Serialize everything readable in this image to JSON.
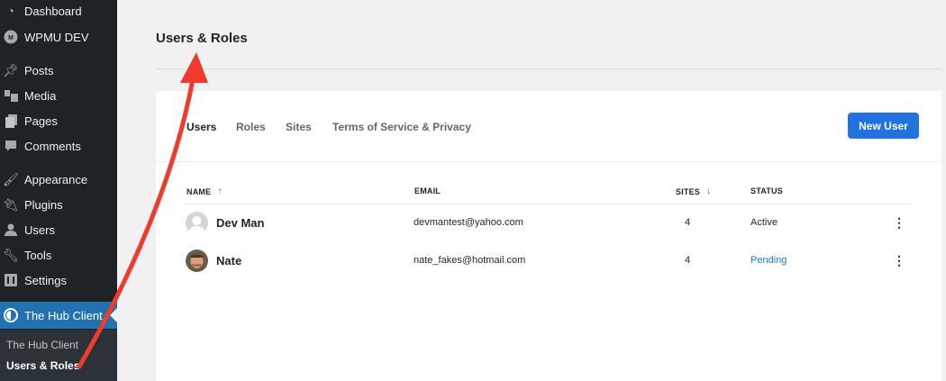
{
  "sidebar": {
    "items": [
      {
        "label": "Dashboard",
        "icon": "dashboard-icon"
      },
      {
        "label": "WPMU DEV",
        "icon": "wpmudev-icon"
      },
      {
        "label": "Posts",
        "icon": "pin-icon"
      },
      {
        "label": "Media",
        "icon": "media-icon"
      },
      {
        "label": "Pages",
        "icon": "pages-icon"
      },
      {
        "label": "Comments",
        "icon": "comment-icon"
      },
      {
        "label": "Appearance",
        "icon": "brush-icon"
      },
      {
        "label": "Plugins",
        "icon": "plugin-icon"
      },
      {
        "label": "Users",
        "icon": "user-icon"
      },
      {
        "label": "Tools",
        "icon": "wrench-icon"
      },
      {
        "label": "Settings",
        "icon": "settings-icon"
      },
      {
        "label": "The Hub Client",
        "icon": "hub-icon"
      }
    ],
    "submenu": [
      "The Hub Client",
      "Users & Roles"
    ]
  },
  "page": {
    "title": "Users & Roles"
  },
  "tabs": [
    "Users",
    "Roles",
    "Sites",
    "Terms of Service & Privacy"
  ],
  "new_user_label": "New User",
  "table": {
    "headers": {
      "name": "NAME",
      "email": "EMAIL",
      "sites": "SITES",
      "status": "STATUS"
    },
    "rows": [
      {
        "name": "Dev Man",
        "email": "devmantest@yahoo.com",
        "sites": "4",
        "status": "Active"
      },
      {
        "name": "Nate",
        "email": "nate_fakes@hotmail.com",
        "sites": "4",
        "status": "Pending"
      }
    ]
  },
  "colors": {
    "sidebar_bg": "#1d2327",
    "active_menu": "#2271b1",
    "primary_button": "#2271e0",
    "pending_status": "#2271e0",
    "annotation_arrow": "#f03a2e"
  }
}
